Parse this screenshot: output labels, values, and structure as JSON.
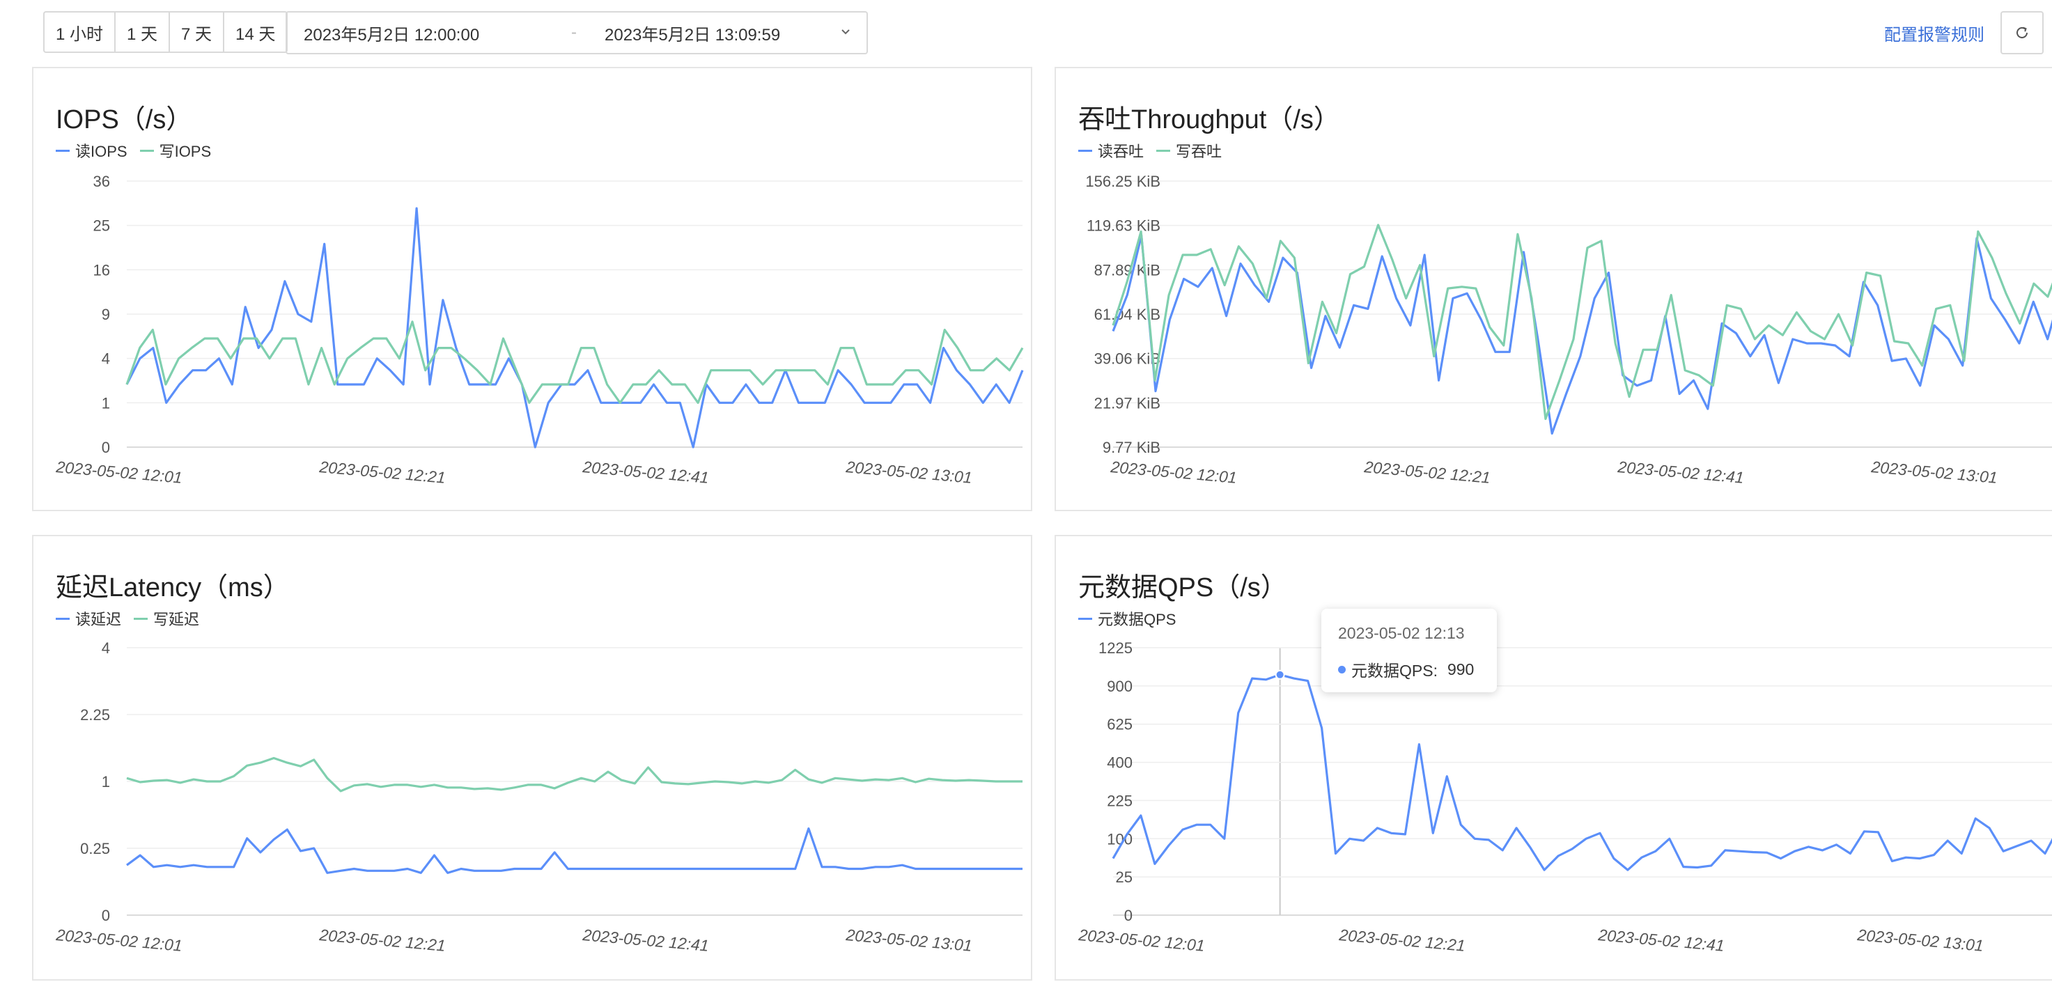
{
  "toolbar": {
    "range_buttons": [
      "1 小时",
      "1 天",
      "7 天",
      "14 天"
    ],
    "start_time": "2023年5月2日 12:00:00",
    "separator": "-",
    "end_time": "2023年5月2日 13:09:59",
    "alarm_link": "配置报警规则"
  },
  "colors": {
    "read": "#5b8ff9",
    "write": "#7fcfae"
  },
  "icons": [
    "chevron-down-icon",
    "refresh-icon"
  ],
  "tooltip": {
    "time": "2023-05-02 12:13",
    "label": "元数据QPS:",
    "value": "990"
  },
  "chart_data": [
    {
      "type": "line",
      "title": "IOPS（/s）",
      "yscale": "sqrt",
      "yticks": [
        "0",
        "1",
        "4",
        "9",
        "16",
        "25",
        "36"
      ],
      "ytick_values": [
        0,
        1,
        4,
        9,
        16,
        25,
        36
      ],
      "xticks": [
        "2023-05-02 12:01",
        "2023-05-02 12:21",
        "2023-05-02 12:41",
        "2023-05-02 13:01"
      ],
      "series": [
        {
          "name": "读IOPS",
          "color": "#5b8ff9",
          "values": [
            2,
            4,
            5,
            1,
            2,
            3,
            3,
            4,
            2,
            10,
            5,
            7,
            14,
            9,
            8,
            21,
            2,
            2,
            2,
            4,
            3,
            2,
            29,
            2,
            11,
            5,
            2,
            2,
            2,
            4,
            2,
            0,
            1,
            2,
            2,
            3,
            1,
            1,
            1,
            1,
            2,
            1,
            1,
            0,
            2,
            1,
            1,
            2,
            1,
            1,
            3,
            1,
            1,
            1,
            3,
            2,
            1,
            1,
            1,
            2,
            2,
            1,
            5,
            3,
            2,
            1,
            2,
            1,
            3
          ]
        },
        {
          "name": "写IOPS",
          "color": "#7fcfae",
          "values": [
            2,
            5,
            7,
            2,
            4,
            5,
            6,
            6,
            4,
            6,
            6,
            4,
            6,
            6,
            2,
            5,
            2,
            4,
            5,
            6,
            6,
            4,
            8,
            3,
            5,
            5,
            4,
            3,
            2,
            6,
            3,
            1,
            2,
            2,
            2,
            5,
            5,
            2,
            1,
            2,
            2,
            3,
            2,
            2,
            1,
            3,
            3,
            3,
            3,
            2,
            3,
            3,
            3,
            3,
            2,
            5,
            5,
            2,
            2,
            2,
            3,
            3,
            2,
            7,
            5,
            3,
            3,
            4,
            3,
            5
          ]
        }
      ]
    },
    {
      "type": "line",
      "title": "吞吐Throughput（/s）",
      "yscale": "sqrt",
      "yticks": [
        "9.77 KiB",
        "21.97 KiB",
        "39.06 KiB",
        "61.04 KiB",
        "87.89 KiB",
        "119.63 KiB",
        "156.25 KiB"
      ],
      "ytick_values": [
        9.77,
        21.97,
        39.06,
        61.04,
        87.89,
        119.63,
        156.25
      ],
      "xticks": [
        "2023-05-02 12:01",
        "2023-05-02 12:21",
        "2023-05-02 12:41",
        "2023-05-02 13:01"
      ],
      "series": [
        {
          "name": "读吞吐",
          "color": "#5b8ff9",
          "values": [
            52,
            72,
            112,
            26,
            58,
            82,
            77,
            89,
            60,
            92,
            78,
            68,
            96,
            86,
            35,
            60,
            44,
            66,
            64,
            97,
            70,
            55,
            98,
            30,
            70,
            73,
            58,
            42,
            42,
            100,
            48,
            13,
            25,
            40,
            70,
            86,
            32,
            28,
            30,
            60,
            25,
            30,
            20,
            56,
            51,
            40,
            50,
            29,
            48,
            46,
            46,
            45,
            40,
            80,
            66,
            38,
            39,
            28,
            55,
            48,
            36,
            110,
            70,
            58,
            46,
            68,
            48,
            76
          ]
        },
        {
          "name": "写吞吐",
          "color": "#7fcfae",
          "values": [
            55,
            80,
            115,
            30,
            72,
            98,
            98,
            102,
            78,
            104,
            92,
            70,
            108,
            96,
            37,
            68,
            51,
            85,
            90,
            120,
            95,
            70,
            91,
            40,
            76,
            77,
            76,
            54,
            45,
            113,
            70,
            17,
            30,
            48,
            103,
            108,
            46,
            24,
            43,
            43,
            72,
            34,
            32,
            28,
            66,
            64,
            48,
            55,
            50,
            62,
            52,
            48,
            61,
            45,
            86,
            84,
            47,
            46,
            36,
            64,
            66,
            38,
            115,
            96,
            73,
            56,
            79,
            71,
            95
          ]
        }
      ]
    },
    {
      "type": "line",
      "title": "延迟Latency（ms）",
      "yscale": "sqrt",
      "yticks": [
        "0",
        "0.25",
        "1",
        "2.25",
        "4"
      ],
      "ytick_values": [
        0,
        0.25,
        1,
        2.25,
        4
      ],
      "xticks": [
        "2023-05-02 12:01",
        "2023-05-02 12:21",
        "2023-05-02 12:41",
        "2023-05-02 13:01"
      ],
      "series": [
        {
          "name": "读延迟",
          "color": "#5b8ff9",
          "values": [
            0.14,
            0.2,
            0.13,
            0.14,
            0.13,
            0.14,
            0.13,
            0.13,
            0.13,
            0.33,
            0.22,
            0.32,
            0.41,
            0.23,
            0.25,
            0.1,
            0.11,
            0.12,
            0.11,
            0.11,
            0.11,
            0.12,
            0.1,
            0.2,
            0.1,
            0.12,
            0.11,
            0.11,
            0.11,
            0.12,
            0.12,
            0.12,
            0.22,
            0.12,
            0.12,
            0.12,
            0.12,
            0.12,
            0.12,
            0.12,
            0.12,
            0.12,
            0.12,
            0.12,
            0.12,
            0.12,
            0.12,
            0.12,
            0.12,
            0.12,
            0.12,
            0.42,
            0.13,
            0.13,
            0.12,
            0.12,
            0.13,
            0.13,
            0.14,
            0.12,
            0.12,
            0.12,
            0.12,
            0.12,
            0.12,
            0.12,
            0.12,
            0.12
          ]
        },
        {
          "name": "写延迟",
          "color": "#7fcfae",
          "values": [
            1.05,
            0.99,
            1.01,
            1.02,
            0.98,
            1.03,
            1,
            1,
            1.08,
            1.25,
            1.3,
            1.38,
            1.3,
            1.24,
            1.35,
            1.05,
            0.86,
            0.94,
            0.96,
            0.92,
            0.95,
            0.95,
            0.92,
            0.95,
            0.91,
            0.91,
            0.89,
            0.9,
            0.88,
            0.91,
            0.95,
            0.95,
            0.9,
            0.98,
            1.05,
            1,
            1.15,
            1.02,
            0.97,
            1.22,
            0.99,
            0.97,
            0.96,
            0.98,
            1,
            0.99,
            0.97,
            1,
            0.98,
            1.02,
            1.18,
            1.03,
            0.98,
            1.05,
            1.03,
            1.01,
            1.03,
            1.02,
            1.05,
            0.99,
            1.04,
            1.02,
            1.01,
            1.02,
            1.01,
            1,
            1,
            1
          ]
        }
      ]
    },
    {
      "type": "line",
      "title": "元数据QPS（/s）",
      "yscale": "sqrt",
      "yticks": [
        "0",
        "25",
        "100",
        "225",
        "400",
        "625",
        "900",
        "1225"
      ],
      "ytick_values": [
        0,
        25,
        100,
        225,
        400,
        625,
        900,
        1225
      ],
      "xticks": [
        "2023-05-02 12:01",
        "2023-05-02 12:21",
        "2023-05-02 12:41",
        "2023-05-02 13:01"
      ],
      "series": [
        {
          "name": "元数据QPS",
          "color": "#5b8ff9",
          "values": [
            55,
            112,
            170,
            45,
            83,
            125,
            140,
            140,
            100,
            700,
            960,
            950,
            990,
            960,
            940,
            600,
            65,
            100,
            95,
            130,
            115,
            112,
            500,
            115,
            330,
            140,
            100,
            97,
            72,
            130,
            78,
            35,
            60,
            75,
            100,
            115,
            55,
            35,
            57,
            70,
            100,
            40,
            39,
            42,
            72,
            70,
            68,
            67,
            55,
            70,
            80,
            72,
            85,
            65,
            120,
            118,
            50,
            57,
            55,
            62,
            95,
            65,
            160,
            130,
            70,
            82,
            95,
            65,
            132
          ]
        }
      ]
    }
  ]
}
